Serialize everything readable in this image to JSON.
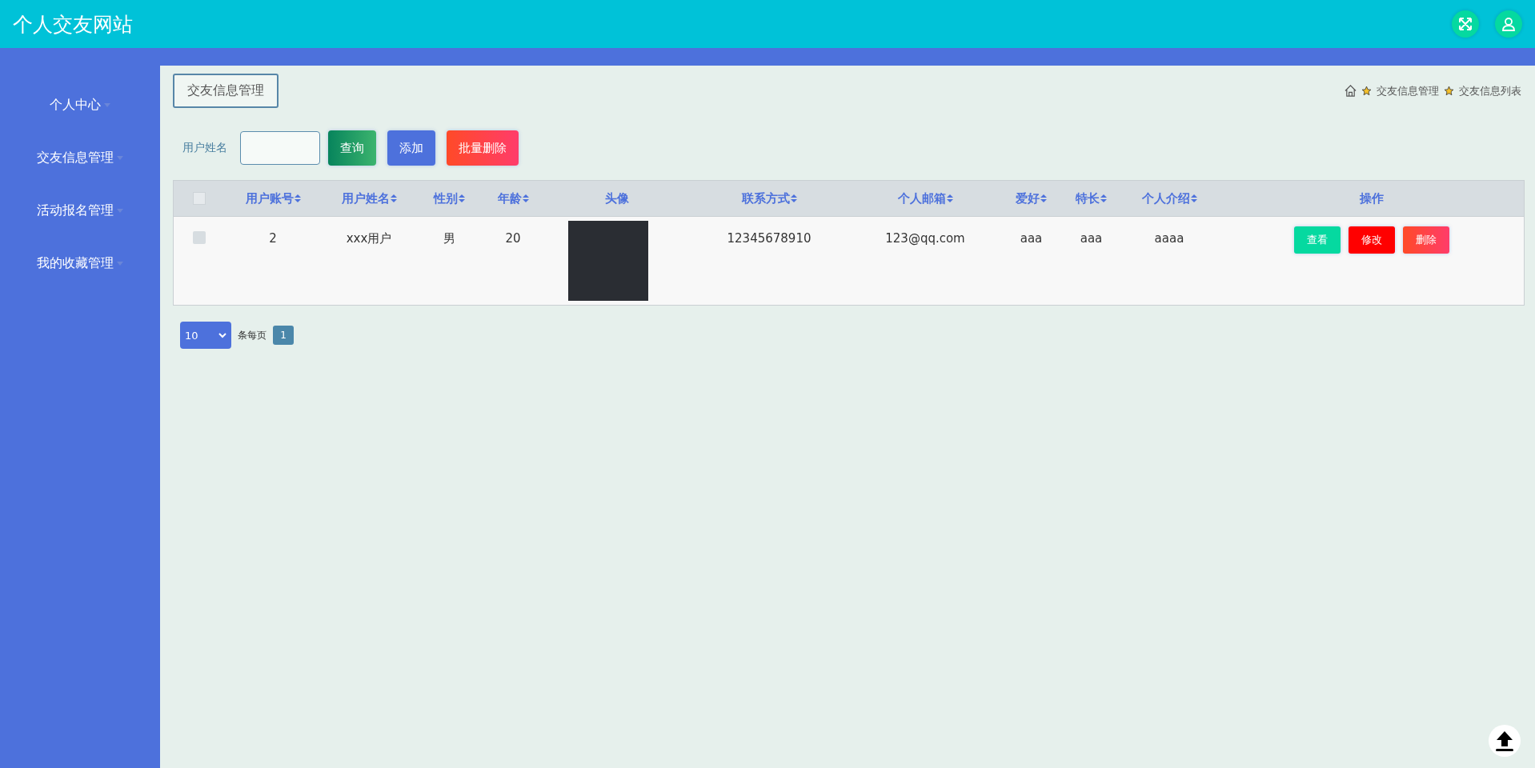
{
  "header": {
    "title": "个人交友网站"
  },
  "sidebar": {
    "items": [
      {
        "label": "个人中心"
      },
      {
        "label": "交友信息管理"
      },
      {
        "label": "活动报名管理"
      },
      {
        "label": "我的收藏管理"
      }
    ]
  },
  "page_title": "交友信息管理",
  "breadcrumb": [
    "交友信息管理",
    "交友信息列表"
  ],
  "search": {
    "label": "用户姓名",
    "buttons": [
      {
        "label": "查询",
        "kind": "search"
      },
      {
        "label": "添加",
        "kind": "add"
      },
      {
        "label": "批量删除",
        "kind": "delete"
      }
    ]
  },
  "table": {
    "columns": [
      {
        "label": "用户账号",
        "sortable": true
      },
      {
        "label": "用户姓名",
        "sortable": true
      },
      {
        "label": "性别",
        "sortable": true
      },
      {
        "label": "年龄",
        "sortable": true
      },
      {
        "label": "头像",
        "sortable": false
      },
      {
        "label": "联系方式",
        "sortable": true
      },
      {
        "label": "个人邮箱",
        "sortable": true
      },
      {
        "label": "爱好",
        "sortable": true
      },
      {
        "label": "特长",
        "sortable": true
      },
      {
        "label": "个人介绍",
        "sortable": true
      },
      {
        "label": "操作",
        "sortable": false
      }
    ],
    "select_all_checked": false,
    "rows": [
      {
        "checked": false,
        "cells": [
          "2",
          "xxx用户",
          "男",
          "20",
          "",
          "12345678910",
          "123@qq.com",
          "aaa",
          "aaa",
          "aaaa"
        ],
        "actions": [
          {
            "label": "查看",
            "kind": "view"
          },
          {
            "label": "修改",
            "kind": "edit"
          },
          {
            "label": "删除",
            "kind": "delete"
          }
        ]
      }
    ]
  },
  "pagination": {
    "page_size": "10",
    "per_page_label": "条每页",
    "pages": [
      {
        "label": "1",
        "selected": true
      }
    ]
  }
}
